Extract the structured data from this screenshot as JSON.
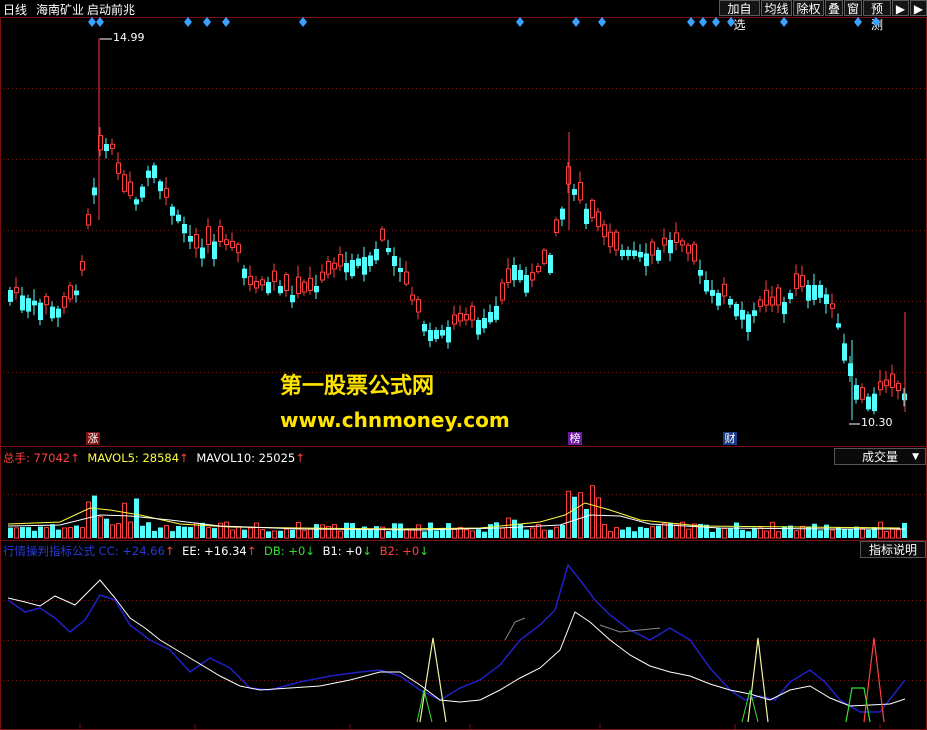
{
  "topbar": {
    "period": "日线",
    "stock_name": "海南矿业",
    "formula_name": "启动前兆",
    "buttons": [
      "加自选",
      "均线",
      "除权",
      "叠",
      "窗",
      "预测"
    ]
  },
  "main_chart": {
    "high_label": "14.99",
    "low_label": "10.30",
    "markers": [
      "涨",
      "榜",
      "财"
    ]
  },
  "watermark": {
    "title": "第一股票公式网",
    "url": "www.chnmoney.com"
  },
  "volume_panel": {
    "total_label": "总手: ",
    "total_value": "77042",
    "total_arrow": "↑",
    "ma5_label": "MAVOL5: 28584",
    "ma5_arrow": "↑",
    "ma10_label": "MAVOL10: 25025",
    "ma10_arrow": "↑",
    "button": "成交量"
  },
  "indicator_panel": {
    "name": "行情操判指标公式 CC: +24.66",
    "name_arrow": "↑",
    "ee": "EE: +16.34",
    "ee_arrow": "↑",
    "db": "DB: +0",
    "db_arrow": "↓",
    "b1": "B1: +0",
    "b1_arrow": "↓",
    "b2": "B2: +0",
    "b2_arrow": "↓",
    "button": "指标说明"
  },
  "colors": {
    "up": "#ff4040",
    "down": "#54ffff",
    "grid": "#7a1010",
    "yellow": "#ffff40",
    "blue": "#2020c8",
    "diamond": "#3ca0ff"
  }
}
